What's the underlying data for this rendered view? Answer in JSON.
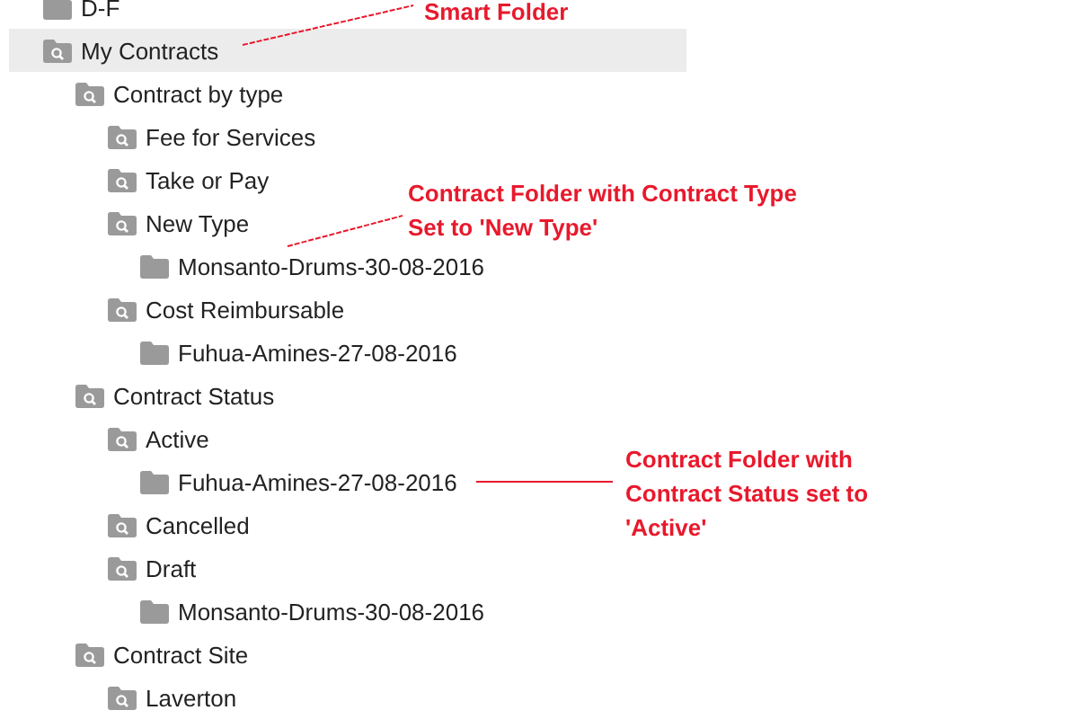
{
  "tree": [
    {
      "label": "D-F",
      "kind": "folder",
      "selected": false
    },
    {
      "label": "My Contracts",
      "kind": "smart",
      "selected": true,
      "children": [
        {
          "label": "Contract by type",
          "kind": "smart",
          "selected": false,
          "children": [
            {
              "label": "Fee for Services",
              "kind": "smart",
              "selected": false
            },
            {
              "label": "Take or Pay",
              "kind": "smart",
              "selected": false
            },
            {
              "label": "New Type",
              "kind": "smart",
              "selected": false,
              "children": [
                {
                  "label": "Monsanto-Drums-30-08-2016",
                  "kind": "folder",
                  "selected": false
                }
              ]
            },
            {
              "label": "Cost Reimbursable",
              "kind": "smart",
              "selected": false,
              "children": [
                {
                  "label": "Fuhua-Amines-27-08-2016",
                  "kind": "folder",
                  "selected": false
                }
              ]
            }
          ]
        },
        {
          "label": "Contract Status",
          "kind": "smart",
          "selected": false,
          "children": [
            {
              "label": "Active",
              "kind": "smart",
              "selected": false,
              "children": [
                {
                  "label": "Fuhua-Amines-27-08-2016",
                  "kind": "folder",
                  "selected": false
                }
              ]
            },
            {
              "label": "Cancelled",
              "kind": "smart",
              "selected": false
            },
            {
              "label": "Draft",
              "kind": "smart",
              "selected": false,
              "children": [
                {
                  "label": "Monsanto-Drums-30-08-2016",
                  "kind": "folder",
                  "selected": false
                }
              ]
            }
          ]
        },
        {
          "label": "Contract Site",
          "kind": "smart",
          "selected": false,
          "children": [
            {
              "label": "Laverton",
              "kind": "smart",
              "selected": false
            }
          ]
        }
      ]
    }
  ],
  "annotations": [
    {
      "lines": [
        "Smart Folder"
      ]
    },
    {
      "lines": [
        "Contract Folder with Contract Type",
        "Set to 'New Type'"
      ]
    },
    {
      "lines": [
        "Contract Folder with",
        "Contract Status set to",
        "'Active'"
      ]
    }
  ]
}
